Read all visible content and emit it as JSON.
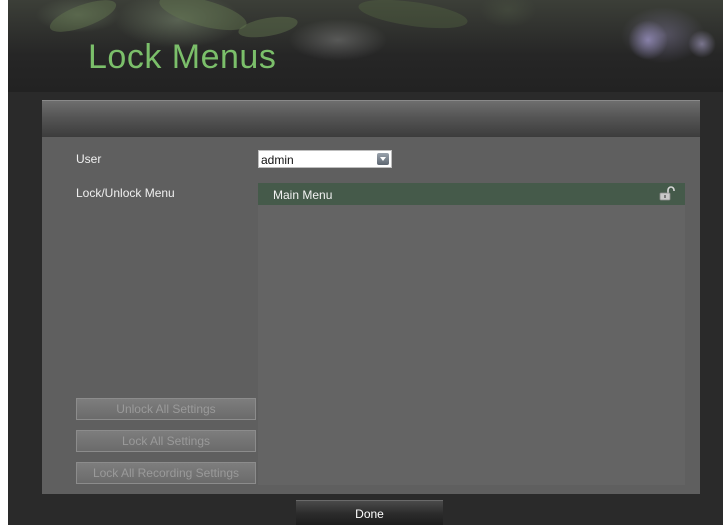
{
  "header": {
    "title": "Lock Menus"
  },
  "form": {
    "user_label": "User",
    "user_value": "admin",
    "lock_label": "Lock/Unlock Menu"
  },
  "menu_list": {
    "items": [
      {
        "label": "Main Menu",
        "icon": "unlocked-padlock-icon"
      }
    ]
  },
  "buttons": {
    "unlock_all": "Unlock All Settings",
    "lock_all": "Lock All Settings",
    "lock_recording": "Lock All Recording Settings",
    "done": "Done"
  },
  "colors": {
    "title": "#7bbf6a",
    "panel": "#5f5f5f",
    "selected_row": "#455a4a"
  }
}
